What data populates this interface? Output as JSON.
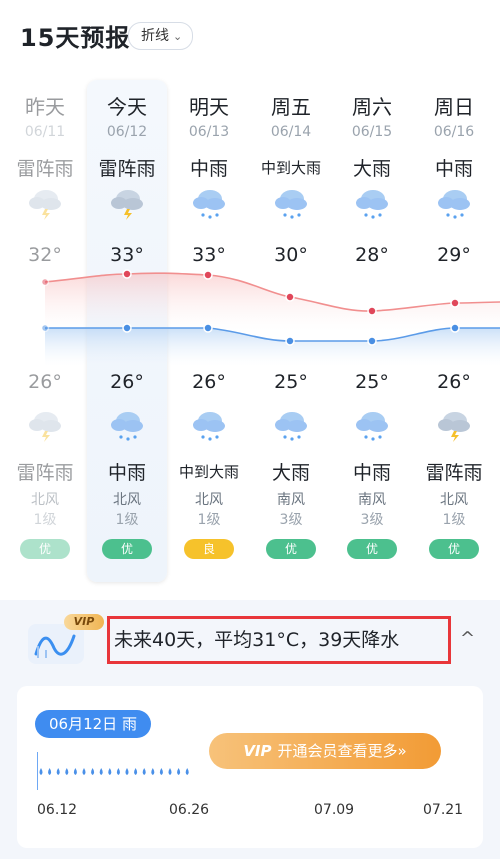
{
  "header": {
    "title": "15天预报",
    "mode_label": "折线",
    "mode_chevron": "⌄"
  },
  "days": [
    {
      "day": "昨天",
      "date": "06/11",
      "cond": "雷阵雨",
      "hi": "32°",
      "lo": "26°",
      "icon": "thunder-rain-icon",
      "night_icon": "thunder-rain-icon",
      "night_cond": "雷阵雨",
      "wind": "北风",
      "level": "1级",
      "aqi": "优",
      "aqi_color": "#4cc08e"
    },
    {
      "day": "今天",
      "date": "06/12",
      "cond": "雷阵雨",
      "hi": "33°",
      "lo": "26°",
      "icon": "thunder-rain-icon",
      "night_icon": "rain-icon",
      "night_cond": "中雨",
      "wind": "北风",
      "level": "1级",
      "aqi": "优",
      "aqi_color": "#4cc08e"
    },
    {
      "day": "明天",
      "date": "06/13",
      "cond": "中雨",
      "hi": "33°",
      "lo": "26°",
      "icon": "rain-icon",
      "night_icon": "rain-icon",
      "night_cond": "中到大雨",
      "wind": "北风",
      "level": "1级",
      "aqi": "良",
      "aqi_color": "#f6c22b"
    },
    {
      "day": "周五",
      "date": "06/14",
      "cond": "中到大雨",
      "hi": "30°",
      "lo": "25°",
      "icon": "rain-icon",
      "night_icon": "rain-icon",
      "night_cond": "大雨",
      "wind": "南风",
      "level": "3级",
      "aqi": "优",
      "aqi_color": "#4cc08e"
    },
    {
      "day": "周六",
      "date": "06/15",
      "cond": "大雨",
      "hi": "28°",
      "lo": "25°",
      "icon": "rain-icon",
      "night_icon": "rain-icon",
      "night_cond": "中雨",
      "wind": "南风",
      "level": "3级",
      "aqi": "优",
      "aqi_color": "#4cc08e"
    },
    {
      "day": "周日",
      "date": "06/16",
      "cond": "中雨",
      "hi": "29°",
      "lo": "26°",
      "icon": "rain-icon",
      "night_icon": "thunder-rain-icon",
      "night_cond": "雷阵雨",
      "wind": "北风",
      "level": "1级",
      "aqi": "优",
      "aqi_color": "#4cc08e"
    }
  ],
  "banner": {
    "vip_badge": "VIP",
    "summary": "未来40天，平均31°C，39天降水",
    "collapse": "^"
  },
  "calendar": {
    "selected_date": "06月12日 雨",
    "vip_tag": "VIP",
    "vip_cta": "开通会员查看更多»",
    "ticks": [
      "06.12",
      "06.26",
      "07.09",
      "07.21"
    ]
  }
}
